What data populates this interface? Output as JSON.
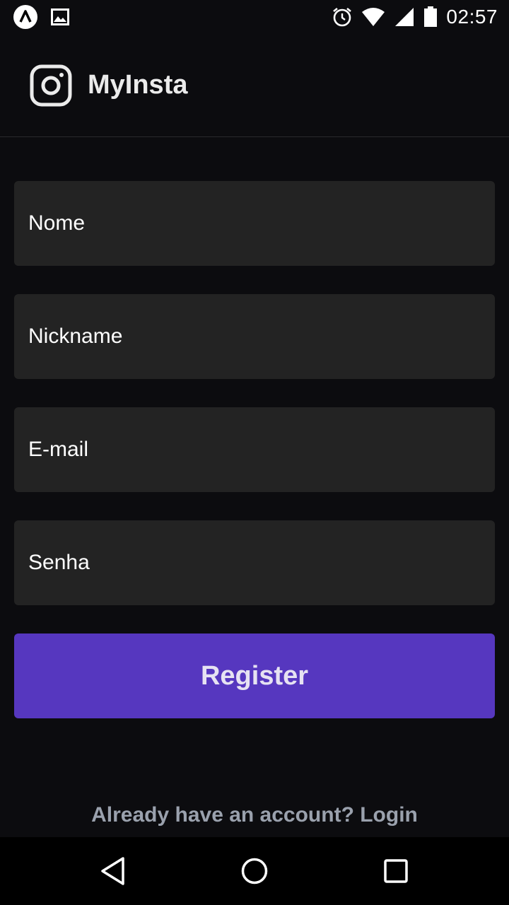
{
  "status_bar": {
    "time": "02:57",
    "left_icons": [
      "app-notification-icon",
      "image-notification-icon"
    ],
    "right_icons": [
      "alarm-icon",
      "wifi-icon",
      "signal-icon",
      "battery-icon"
    ]
  },
  "header": {
    "logo_icon": "instagram-icon",
    "title": "MyInsta"
  },
  "form": {
    "name_placeholder": "Nome",
    "nickname_placeholder": "Nickname",
    "email_placeholder": "E-mail",
    "password_placeholder": "Senha",
    "register_label": "Register"
  },
  "footer": {
    "login_text": "Already have an account? Login"
  },
  "nav_bar": {
    "buttons": [
      "back-icon",
      "home-icon",
      "recents-icon"
    ]
  },
  "colors": {
    "background": "#0c0c0f",
    "field_background": "#232323",
    "accent": "#5637bf",
    "link": "#9aa1ad"
  }
}
